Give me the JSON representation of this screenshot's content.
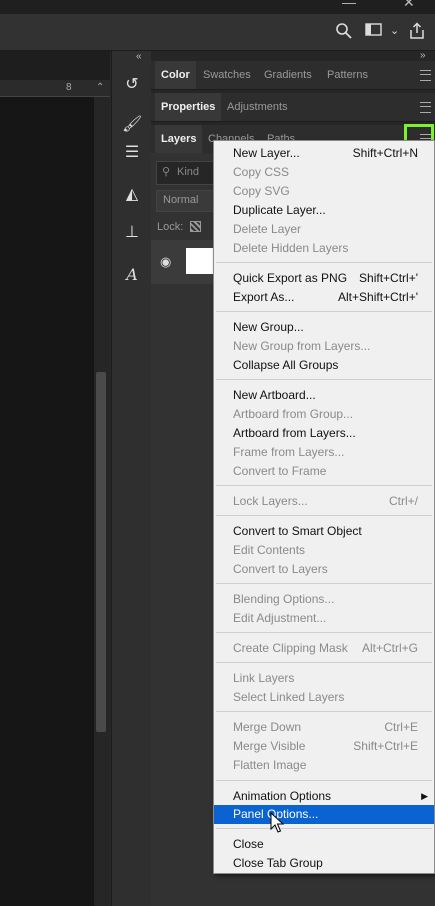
{
  "appbar": {
    "icons": [
      "search-icon",
      "workspace-icon",
      "chevron-down-icon",
      "share-icon"
    ]
  },
  "ruler": {
    "tick_label": "8"
  },
  "panels": {
    "row1_tabs": [
      "Color",
      "Swatches",
      "Gradients",
      "Patterns"
    ],
    "row2_tabs": [
      "Properties",
      "Adjustments"
    ],
    "row3_tabs": [
      "Layers",
      "Channels",
      "Paths"
    ]
  },
  "layers": {
    "kind_placeholder": "Kind",
    "blend_mode": "Normal",
    "lock_label": "Lock:"
  },
  "menu": {
    "items": [
      {
        "label": "New Layer...",
        "shortcut": "Shift+Ctrl+N",
        "enabled": true
      },
      {
        "label": "Copy CSS",
        "shortcut": "",
        "enabled": false
      },
      {
        "label": "Copy SVG",
        "shortcut": "",
        "enabled": false
      },
      {
        "label": "Duplicate Layer...",
        "shortcut": "",
        "enabled": true
      },
      {
        "label": "Delete Layer",
        "shortcut": "",
        "enabled": false
      },
      {
        "label": "Delete Hidden Layers",
        "shortcut": "",
        "enabled": false
      },
      {
        "label": "Quick Export as PNG",
        "shortcut": "Shift+Ctrl+'",
        "enabled": true
      },
      {
        "label": "Export As...",
        "shortcut": "Alt+Shift+Ctrl+'",
        "enabled": true
      },
      {
        "label": "New Group...",
        "shortcut": "",
        "enabled": true
      },
      {
        "label": "New Group from Layers...",
        "shortcut": "",
        "enabled": false
      },
      {
        "label": "Collapse All Groups",
        "shortcut": "",
        "enabled": true
      },
      {
        "label": "New Artboard...",
        "shortcut": "",
        "enabled": true
      },
      {
        "label": "Artboard from Group...",
        "shortcut": "",
        "enabled": false
      },
      {
        "label": "Artboard from Layers...",
        "shortcut": "",
        "enabled": true
      },
      {
        "label": "Frame from Layers...",
        "shortcut": "",
        "enabled": false
      },
      {
        "label": "Convert to Frame",
        "shortcut": "",
        "enabled": false
      },
      {
        "label": "Lock Layers...",
        "shortcut": "Ctrl+/",
        "enabled": false
      },
      {
        "label": "Convert to Smart Object",
        "shortcut": "",
        "enabled": true
      },
      {
        "label": "Edit Contents",
        "shortcut": "",
        "enabled": false
      },
      {
        "label": "Convert to Layers",
        "shortcut": "",
        "enabled": false
      },
      {
        "label": "Blending Options...",
        "shortcut": "",
        "enabled": false
      },
      {
        "label": "Edit Adjustment...",
        "shortcut": "",
        "enabled": false
      },
      {
        "label": "Create Clipping Mask",
        "shortcut": "Alt+Ctrl+G",
        "enabled": false
      },
      {
        "label": "Link Layers",
        "shortcut": "",
        "enabled": false
      },
      {
        "label": "Select Linked Layers",
        "shortcut": "",
        "enabled": false
      },
      {
        "label": "Merge Down",
        "shortcut": "Ctrl+E",
        "enabled": false
      },
      {
        "label": "Merge Visible",
        "shortcut": "Shift+Ctrl+E",
        "enabled": false
      },
      {
        "label": "Flatten Image",
        "shortcut": "",
        "enabled": false
      },
      {
        "label": "Animation Options",
        "shortcut": "",
        "enabled": true,
        "submenu": true
      },
      {
        "label": "Panel Options...",
        "shortcut": "",
        "enabled": true,
        "highlighted": true
      },
      {
        "label": "Close",
        "shortcut": "",
        "enabled": true
      },
      {
        "label": "Close Tab Group",
        "shortcut": "",
        "enabled": true
      }
    ]
  },
  "colors": {
    "highlight": "#7cf12c",
    "selection": "#0a63d1"
  }
}
